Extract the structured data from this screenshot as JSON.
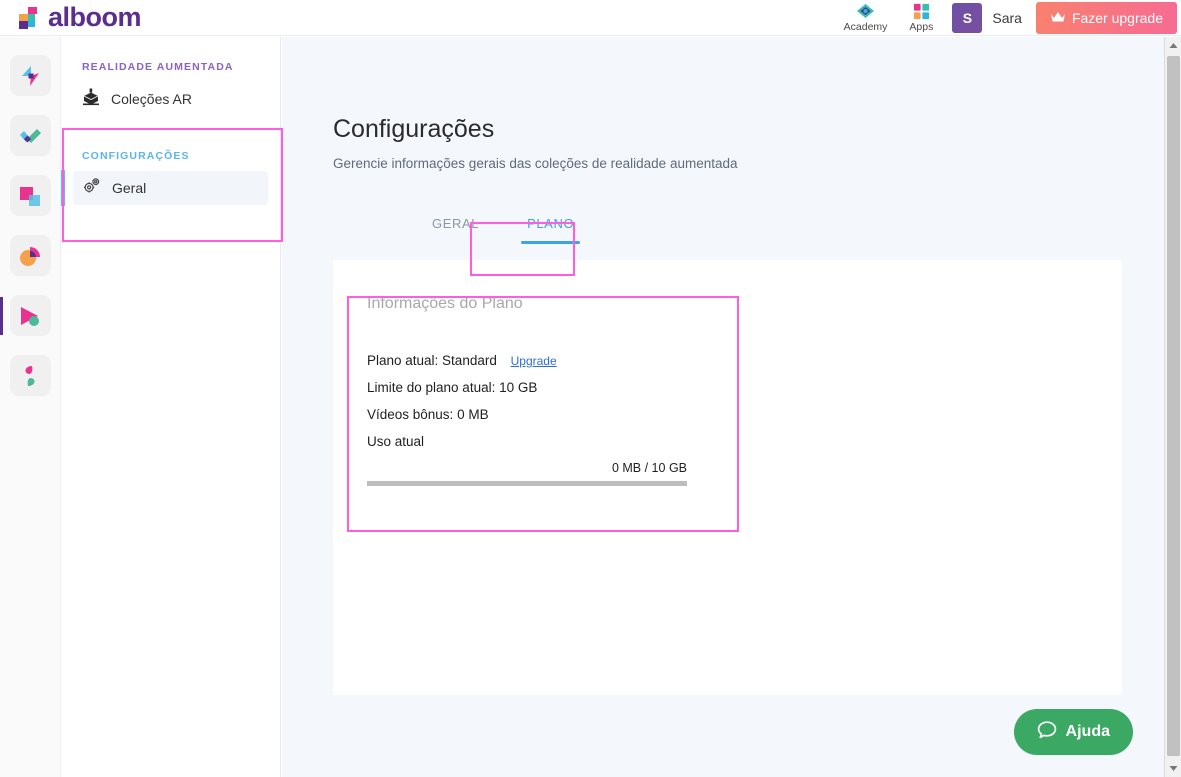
{
  "header": {
    "brand": "alboom",
    "brand_icon": "alboom-logo-icon",
    "academy": {
      "label": "Academy",
      "icon": "academy-diamond-icon"
    },
    "apps": {
      "label": "Apps",
      "icon": "apps-grid-icon"
    },
    "user": {
      "initial": "S",
      "name": "Sara"
    },
    "upgrade": {
      "label": "Fazer upgrade",
      "icon": "crown-icon"
    }
  },
  "rail": {
    "items": [
      {
        "name": "bolt-app-icon"
      },
      {
        "name": "check-app-icon"
      },
      {
        "name": "squares-app-icon"
      },
      {
        "name": "piechart-app-icon"
      },
      {
        "name": "play-app-icon"
      },
      {
        "name": "leaf-app-icon"
      }
    ]
  },
  "sidebar": {
    "groups": [
      {
        "label": "REALIDADE AUMENTADA",
        "items": [
          {
            "label": "Coleções AR",
            "icon": "ar-object-icon",
            "active": false
          }
        ]
      },
      {
        "label": "CONFIGURAÇÕES",
        "items": [
          {
            "label": "Geral",
            "icon": "gears-icon",
            "active": true
          }
        ]
      }
    ]
  },
  "main": {
    "title": "Configurações",
    "subtitle": "Gerencie informações gerais das coleções de realidade aumentada",
    "tabs": [
      {
        "label": "GERAL",
        "active": false
      },
      {
        "label": "PLANO",
        "active": true
      }
    ],
    "plan": {
      "heading": "Informações do Plano",
      "current_plan_label": "Plano atual: Standard",
      "upgrade_link": "Upgrade",
      "limit_label": "Limite do plano atual: 10 GB",
      "bonus_label": "Vídeos bônus: 0 MB",
      "usage_label": "Uso atual",
      "usage_value": "0 MB / 10 GB",
      "usage_percent": 0
    }
  },
  "help": {
    "label": "Ajuda",
    "icon": "chat-bubble-icon"
  },
  "colors": {
    "brand_purple": "#5b2d8e",
    "accent_blue": "#3ba3e8",
    "annotation_pink": "#ff5ce0",
    "help_green": "#3ba863",
    "upgrade_gradient_start": "#f9816e",
    "upgrade_gradient_end": "#f76b94"
  }
}
